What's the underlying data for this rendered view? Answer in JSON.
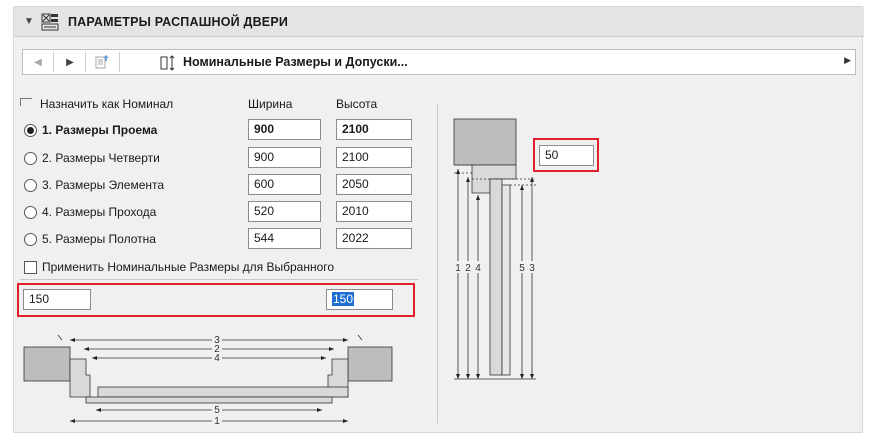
{
  "header": {
    "title": "ПАРАМЕТРЫ РАСПАШНОЙ ДВЕРИ",
    "icon": "door-parameters-icon"
  },
  "toolbar": {
    "page_title": "Номинальные Размеры и Допуски..."
  },
  "sizes": {
    "nominal_label": "Назначить как Номинал",
    "width_header": "Ширина",
    "height_header": "Высота",
    "rows": [
      {
        "label": "1. Размеры Проема",
        "width": "900",
        "height": "2100",
        "selected": true
      },
      {
        "label": "2. Размеры Четверти",
        "width": "900",
        "height": "2100",
        "selected": false
      },
      {
        "label": "3. Размеры Элемента",
        "width": "600",
        "height": "2050",
        "selected": false
      },
      {
        "label": "4. Размеры Прохода",
        "width": "520",
        "height": "2010",
        "selected": false
      },
      {
        "label": "5. Размеры Полотна",
        "width": "544",
        "height": "2022",
        "selected": false
      }
    ],
    "apply_label": "Применить Номинальные Размеры для Выбранного"
  },
  "offsets": {
    "left_value": "150",
    "right_value": "150",
    "top_value": "50"
  },
  "plan_diagram": {
    "labels": [
      "3",
      "2",
      "4",
      "5",
      "1"
    ]
  },
  "section_diagram": {
    "labels": [
      "1",
      "2",
      "4",
      "5",
      "3"
    ]
  },
  "colors": {
    "highlight": "#e0202a",
    "selection": "#1e6fd0"
  }
}
